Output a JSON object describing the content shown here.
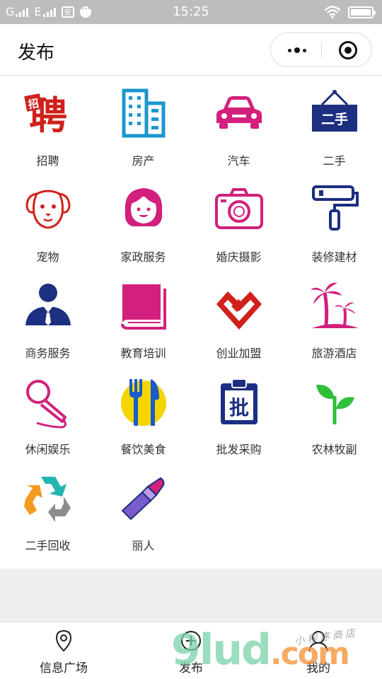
{
  "status_bar": {
    "carrier1": "G",
    "carrier2": "E",
    "app_badge": "安",
    "time": "15:25"
  },
  "nav": {
    "title": "发布"
  },
  "colors": {
    "red": "#d0211c",
    "blue": "#1a97cf",
    "magenta": "#d2207c",
    "navy": "#1c2f80",
    "green": "#2fbf3a",
    "yellow": "#f4d500",
    "purple": "#7a5ccd"
  },
  "categories": [
    {
      "label": "招聘",
      "icon": "recruit-icon"
    },
    {
      "label": "房产",
      "icon": "building-icon"
    },
    {
      "label": "汽车",
      "icon": "car-icon"
    },
    {
      "label": "二手",
      "icon": "secondhand-sign-icon"
    },
    {
      "label": "宠物",
      "icon": "dog-icon"
    },
    {
      "label": "家政服务",
      "icon": "housekeeper-icon"
    },
    {
      "label": "婚庆摄影",
      "icon": "camera-icon"
    },
    {
      "label": "装修建材",
      "icon": "paint-roller-icon"
    },
    {
      "label": "商务服务",
      "icon": "business-person-icon"
    },
    {
      "label": "教育培训",
      "icon": "book-icon"
    },
    {
      "label": "创业加盟",
      "icon": "handshake-icon"
    },
    {
      "label": "旅游酒店",
      "icon": "palm-tree-icon"
    },
    {
      "label": "休闲娱乐",
      "icon": "microphone-icon"
    },
    {
      "label": "餐饮美食",
      "icon": "fork-knife-icon"
    },
    {
      "label": "批发采购",
      "icon": "wholesale-clipboard-icon"
    },
    {
      "label": "农林牧副",
      "icon": "sprout-icon"
    },
    {
      "label": "二手回收",
      "icon": "recycle-icon"
    },
    {
      "label": "丽人",
      "icon": "lipstick-icon"
    }
  ],
  "icon_text": {
    "recruit_main": "聘",
    "recruit_small": "招",
    "secondhand": "二手",
    "wholesale": "批"
  },
  "tabbar": [
    {
      "label": "信息广场",
      "icon": "location-pin-icon"
    },
    {
      "label": "发布",
      "icon": "plus-icon"
    },
    {
      "label": "我的",
      "icon": "user-icon"
    }
  ],
  "watermark": {
    "main": "9lud",
    "dot": ".com",
    "sub": "小程序商店"
  }
}
